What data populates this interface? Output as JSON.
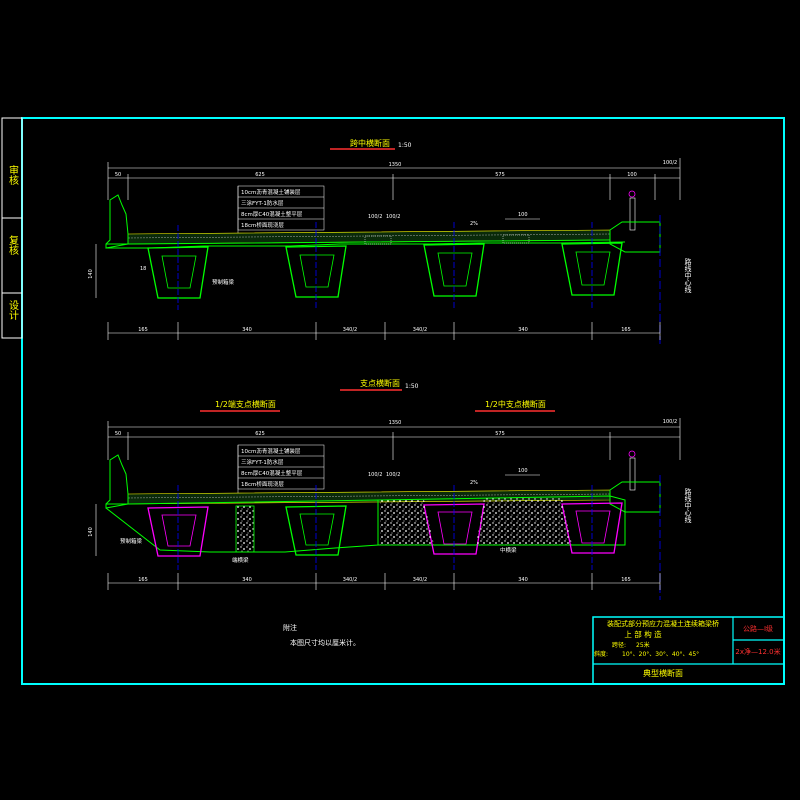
{
  "side_stamps": [
    "审核",
    "复核",
    "设计"
  ],
  "view_top": {
    "title": "跨中横断面",
    "scale": "1:50",
    "total_width": "1350",
    "half_width_right": "100/2",
    "dims_top": [
      "50",
      "625",
      "575",
      "100"
    ],
    "layers": [
      "10cm沥青混凝土铺装层",
      "三涂FYT-1防水层",
      "8cm厚C40混凝土整平层",
      "18cm桥面现浇层"
    ],
    "local_dims": [
      "100/2",
      "100/2",
      "2%",
      "100"
    ],
    "left_label": "18",
    "height_label": "140",
    "beam_label": "预制箱梁",
    "dims_bottom": [
      "165",
      "340",
      "340/2",
      "340/2",
      "340",
      "165"
    ],
    "center_line_label": "路线中心线"
  },
  "view_bottom": {
    "title": "支点横断面",
    "scale": "1:50",
    "sub_left": "1/2端支点横断面",
    "sub_right": "1/2中支点横断面",
    "total_width": "1350",
    "half_width_right": "100/2",
    "dims_top": [
      "50",
      "625",
      "575"
    ],
    "layers": [
      "10cm沥青混凝土铺装层",
      "三涂FYT-1防水层",
      "8cm厚C40混凝土整平层",
      "18cm桥面现浇层"
    ],
    "local_dims": [
      "100/2",
      "100/2",
      "2%",
      "100"
    ],
    "height_label": "140",
    "labels": [
      "预制箱梁",
      "端横梁",
      "中横梁"
    ],
    "dims_bottom": [
      "165",
      "340",
      "340/2",
      "340/2",
      "340",
      "165"
    ],
    "center_line_label": "路线中心线"
  },
  "notes": {
    "heading": "附注",
    "text": "本图尺寸均以厘米计。"
  },
  "title_block": {
    "project": "装配式部分预应力混凝土连续箱梁桥",
    "part": "上 部 构 造",
    "span_key": "跨径:",
    "span_val": "25米",
    "skew_key": "斜度:",
    "skew_val": "10°、20°、30°、40°、45°",
    "drawing": "典型横断面",
    "grade": "公路—Ⅰ级",
    "lanes": "2x净—12.0米"
  },
  "colors": {
    "frame": "#00ffff",
    "beam": "#00ff00",
    "diaphragm": "#ff00ff",
    "dims": "#ffffff",
    "text_yellow": "#ffff00",
    "centerline": "#0000ff",
    "title_red": "#ff3030"
  }
}
